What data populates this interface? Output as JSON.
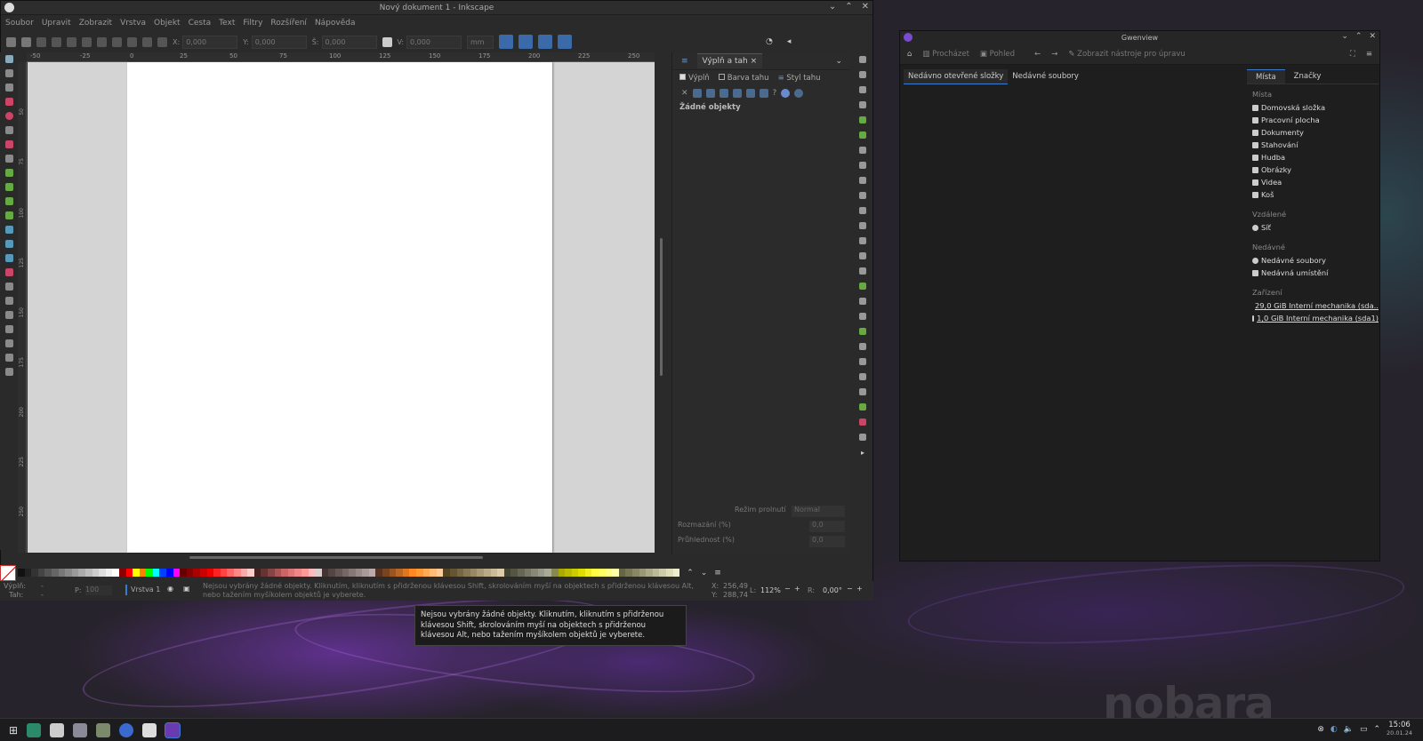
{
  "inkscape": {
    "title": "Nový dokument 1 - Inkscape",
    "menu": [
      "Soubor",
      "Upravit",
      "Zobrazit",
      "Vrstva",
      "Objekt",
      "Cesta",
      "Text",
      "Filtry",
      "Rozšíření",
      "Nápověda"
    ],
    "fields": {
      "x_label": "X:",
      "x": "0,000",
      "y_label": "Y:",
      "y": "0,000",
      "w_label": "Š:",
      "w": "0,000",
      "h_label": "V:",
      "h": "0,000",
      "unit": "mm"
    },
    "ruler_ticks": [
      "-50",
      "-25",
      "0",
      "25",
      "50",
      "75",
      "100",
      "125",
      "150",
      "175",
      "200",
      "225",
      "250"
    ],
    "vruler_ticks": [
      "50",
      "75",
      "100",
      "125",
      "150",
      "175",
      "200",
      "225",
      "250"
    ],
    "panel": {
      "tab": "Výplň a tah",
      "tab_close": "×",
      "sub_fill": "Výplň",
      "sub_stroke_paint": "Barva tahu",
      "sub_stroke_style": "Styl tahu",
      "no_objects": "Žádné objekty",
      "blend_label": "Režim prolnutí",
      "blend_value": "Normal",
      "blur_label": "Rozmazání (%)",
      "blur_value": "0,0",
      "opacity_label": "Průhlednost (%)",
      "opacity_value": "0,0"
    },
    "status": {
      "fill_label": "Výplň:",
      "stroke_label": "Tah:",
      "fill_val": "-",
      "stroke_val": "-",
      "o_label": "P:",
      "o_val": "100",
      "layer": "Vrstva 1",
      "message": "Nejsou vybrány žádné objekty. Kliknutím, kliknutím s přidrženou klávesou Shift, skrolováním myší na objektech s přidrženou klávesou Alt, nebo tažením myšíkolem objektů je vyberete.",
      "x_label": "X:",
      "x": "256,49",
      "y_label": "Y:",
      "y": "288,74",
      "zoom_label": "L:",
      "zoom": "112%",
      "rot_label": "R:",
      "rot": "0,00°"
    },
    "tooltip": "Nejsou vybrány žádné objekty. Kliknutím, kliknutím s přidrženou klávesou Shift, skrolováním myší na objektech s přidrženou klávesou Alt, nebo tažením myšíkolem objektů je vyberete."
  },
  "gwenview": {
    "title": "Gwenview",
    "toolbar": {
      "browse": "Procházet",
      "view": "Pohled",
      "edit_tools": "Zobrazit nástroje pro úpravu"
    },
    "left_tabs": [
      "Nedávno otevřené složky",
      "Nedávné soubory"
    ],
    "right_tabs": [
      "Místa",
      "Značky"
    ],
    "sections": [
      {
        "title": "Místa",
        "items": [
          "Domovská složka",
          "Pracovní plocha",
          "Dokumenty",
          "Stahování",
          "Hudba",
          "Obrázky",
          "Videa",
          "Koš"
        ]
      },
      {
        "title": "Vzdálené",
        "items": [
          "Síť"
        ]
      },
      {
        "title": "Nedávné",
        "items": [
          "Nedávné soubory",
          "Nedávná umístění"
        ]
      },
      {
        "title": "Zařízení",
        "items": [
          "29,0 GiB Interní mechanika (sda...",
          "1,0 GiB Interní mechanika (sda1)"
        ]
      }
    ]
  },
  "desktop": {
    "watermark": "nobara"
  },
  "taskbar": {
    "time": "15:06",
    "date": "20.01.24"
  },
  "colors": {
    "accent": "#3a7ad0",
    "inkscape_bg": "#2a2a2a",
    "gwenview_bg": "#1e1e1e"
  }
}
